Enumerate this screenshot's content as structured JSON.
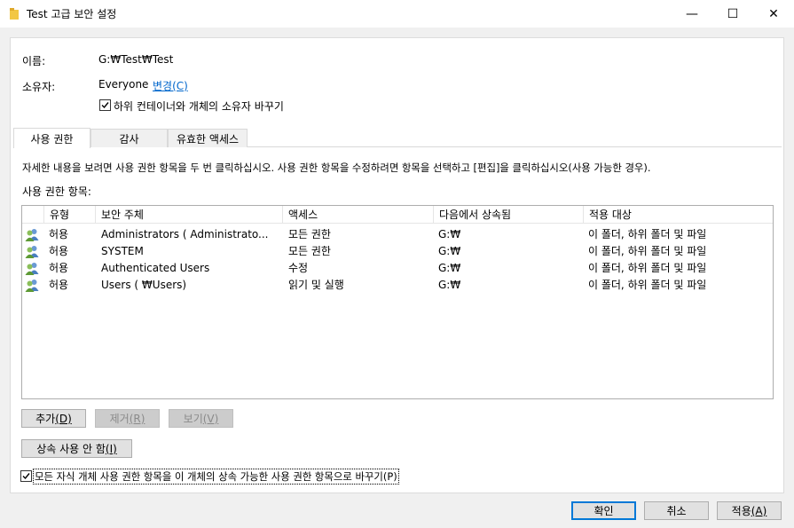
{
  "window": {
    "title": "Test 고급 보안 설정",
    "controls": {
      "minimize": "—",
      "maximize": "☐",
      "close": "✕"
    }
  },
  "info": {
    "name_label": "이름:",
    "name_value": "G:₩Test₩Test",
    "owner_label": "소유자:",
    "owner_value": "Everyone",
    "owner_change_link": "변경(C)",
    "replace_owner_checkbox": {
      "label": "하위 컨테이너와 개체의 소유자 바꾸기",
      "checked": true
    }
  },
  "tabs": [
    {
      "label": "사용 권한",
      "active": true
    },
    {
      "label": "감사",
      "active": false
    },
    {
      "label": "유효한 액세스",
      "active": false
    }
  ],
  "instructions": "자세한 내용을 보려면 사용 권한 항목을 두 번 클릭하십시오. 사용 권한 항목을 수정하려면 항목을 선택하고 [편집]을 클릭하십시오(사용 가능한 경우).",
  "entries_label": "사용 권한 항목:",
  "table": {
    "columns": [
      "유형",
      "보안 주체",
      "액세스",
      "다음에서 상속됨",
      "적용 대상"
    ],
    "rows": [
      {
        "type": "허용",
        "principal": "Administrators (        Administrato...",
        "access": "모든 권한",
        "inherited": "G:₩",
        "applies": "이 폴더, 하위 폴더 및 파일"
      },
      {
        "type": "허용",
        "principal": "SYSTEM",
        "access": "모든 권한",
        "inherited": "G:₩",
        "applies": "이 폴더, 하위 폴더 및 파일"
      },
      {
        "type": "허용",
        "principal": "Authenticated Users",
        "access": "수정",
        "inherited": "G:₩",
        "applies": "이 폴더, 하위 폴더 및 파일"
      },
      {
        "type": "허용",
        "principal": "Users (        ₩Users)",
        "access": "읽기 및 실행",
        "inherited": "G:₩",
        "applies": "이 폴더, 하위 폴더 및 파일"
      }
    ]
  },
  "buttons": {
    "add": {
      "text": "추가",
      "key": "(D)"
    },
    "remove": {
      "text": "제거",
      "key": "(R)"
    },
    "view": {
      "text": "보기",
      "key": "(V)"
    },
    "disable_inheritance": {
      "text": "상속 사용 안 함",
      "key": "(I)"
    },
    "ok": "확인",
    "cancel": "취소",
    "apply": {
      "text": "적용",
      "key": "(A)"
    }
  },
  "replace_child_checkbox": {
    "label": "모든 자식 개체 사용 권한 항목을 이 개체의 상속 가능한 사용 권한 항목으로 바꾸기(P)",
    "checked": true
  },
  "colors": {
    "link": "#0066cc",
    "focus": "#0078d7",
    "folder_icon": "#f2c744"
  }
}
